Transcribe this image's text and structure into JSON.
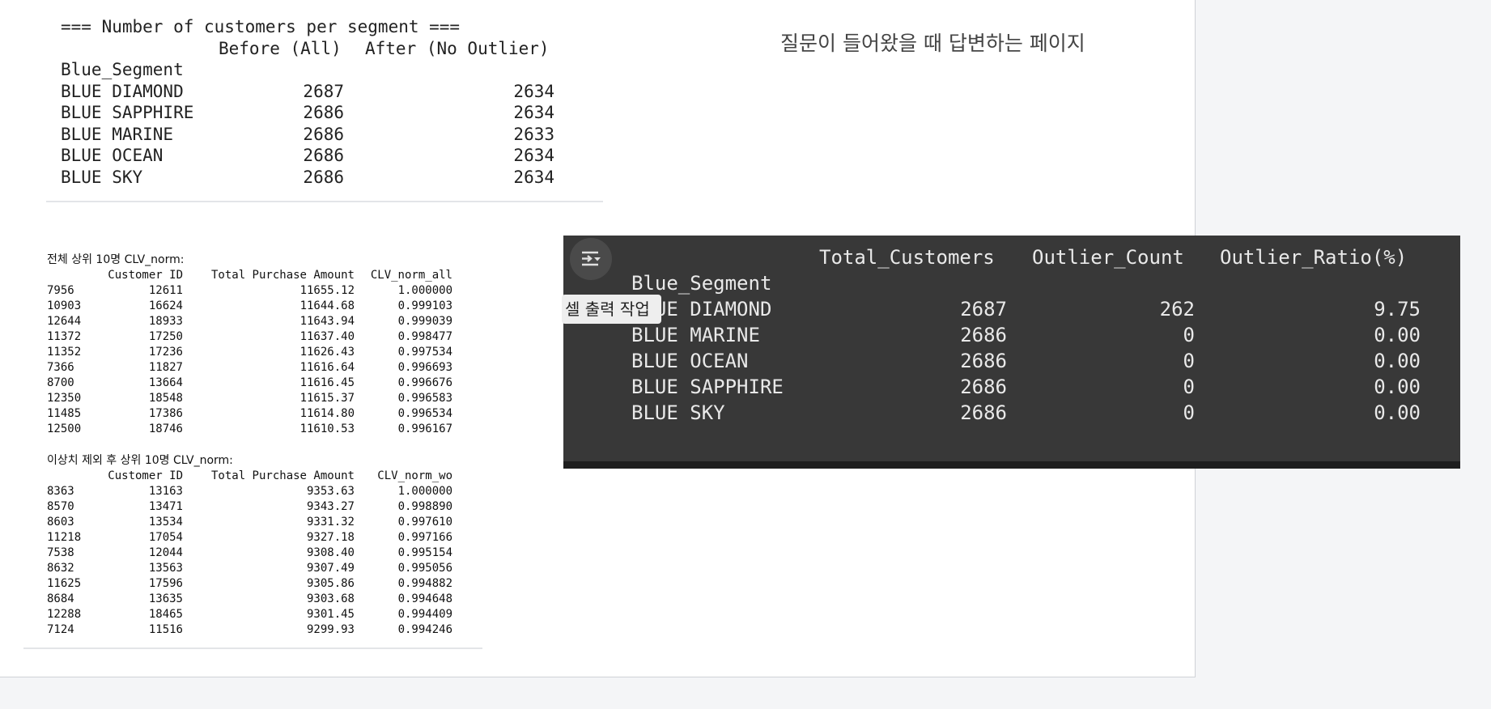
{
  "page_caption": "질문이 들어왔을 때 답변하는 페이지",
  "segment_counts": {
    "title": "=== Number of customers per segment ===",
    "col_before": "Before (All)",
    "col_after": "After (No Outlier)",
    "index_name": "Blue_Segment",
    "rows": [
      {
        "name": "BLUE DIAMOND",
        "before": "2687",
        "after": "2634"
      },
      {
        "name": "BLUE SAPPHIRE",
        "before": "2686",
        "after": "2634"
      },
      {
        "name": "BLUE MARINE",
        "before": "2686",
        "after": "2633"
      },
      {
        "name": "BLUE OCEAN",
        "before": "2686",
        "after": "2634"
      },
      {
        "name": "BLUE SKY",
        "before": "2686",
        "after": "2634"
      }
    ]
  },
  "top10_all": {
    "caption": "전체 상위 10명 CLV_norm:",
    "headers": {
      "customer_id": "Customer ID",
      "total_purchase": "Total Purchase Amount",
      "clv": "CLV_norm_all"
    },
    "rows": [
      {
        "idx": "7956",
        "cid": "12611",
        "tpa": "11655.12",
        "clv": "1.000000"
      },
      {
        "idx": "10903",
        "cid": "16624",
        "tpa": "11644.68",
        "clv": "0.999103"
      },
      {
        "idx": "12644",
        "cid": "18933",
        "tpa": "11643.94",
        "clv": "0.999039"
      },
      {
        "idx": "11372",
        "cid": "17250",
        "tpa": "11637.40",
        "clv": "0.998477"
      },
      {
        "idx": "11352",
        "cid": "17236",
        "tpa": "11626.43",
        "clv": "0.997534"
      },
      {
        "idx": "7366",
        "cid": "11827",
        "tpa": "11616.64",
        "clv": "0.996693"
      },
      {
        "idx": "8700",
        "cid": "13664",
        "tpa": "11616.45",
        "clv": "0.996676"
      },
      {
        "idx": "12350",
        "cid": "18548",
        "tpa": "11615.37",
        "clv": "0.996583"
      },
      {
        "idx": "11485",
        "cid": "17386",
        "tpa": "11614.80",
        "clv": "0.996534"
      },
      {
        "idx": "12500",
        "cid": "18746",
        "tpa": "11610.53",
        "clv": "0.996167"
      }
    ]
  },
  "top10_wo": {
    "caption": "이상치 제외 후 상위 10명 CLV_norm:",
    "headers": {
      "customer_id": "Customer ID",
      "total_purchase": "Total Purchase Amount",
      "clv": "CLV_norm_wo"
    },
    "rows": [
      {
        "idx": "8363",
        "cid": "13163",
        "tpa": "9353.63",
        "clv": "1.000000"
      },
      {
        "idx": "8570",
        "cid": "13471",
        "tpa": "9343.27",
        "clv": "0.998890"
      },
      {
        "idx": "8603",
        "cid": "13534",
        "tpa": "9331.32",
        "clv": "0.997610"
      },
      {
        "idx": "11218",
        "cid": "17054",
        "tpa": "9327.18",
        "clv": "0.997166"
      },
      {
        "idx": "7538",
        "cid": "12044",
        "tpa": "9308.40",
        "clv": "0.995154"
      },
      {
        "idx": "8632",
        "cid": "13563",
        "tpa": "9307.49",
        "clv": "0.995056"
      },
      {
        "idx": "11625",
        "cid": "17596",
        "tpa": "9305.86",
        "clv": "0.994882"
      },
      {
        "idx": "8684",
        "cid": "13635",
        "tpa": "9303.68",
        "clv": "0.994648"
      },
      {
        "idx": "12288",
        "cid": "18465",
        "tpa": "9301.45",
        "clv": "0.994409"
      },
      {
        "idx": "7124",
        "cid": "11516",
        "tpa": "9299.93",
        "clv": "0.994246"
      }
    ]
  },
  "outlier_table": {
    "headers": {
      "total": "Total_Customers",
      "count": "Outlier_Count",
      "ratio": "Outlier_Ratio(%)"
    },
    "index_name": "Blue_Segment",
    "rows": [
      {
        "name": "BLUE DIAMOND",
        "total": "2687",
        "count": "262",
        "ratio": "9.75"
      },
      {
        "name": "BLUE MARINE",
        "total": "2686",
        "count": "0",
        "ratio": "0.00"
      },
      {
        "name": "BLUE OCEAN",
        "total": "2686",
        "count": "0",
        "ratio": "0.00"
      },
      {
        "name": "BLUE SAPPHIRE",
        "total": "2686",
        "count": "0",
        "ratio": "0.00"
      },
      {
        "name": "BLUE SKY",
        "total": "2686",
        "count": "0",
        "ratio": "0.00"
      }
    ]
  },
  "tooltip": "셀 출력 작업",
  "output_action_icon": "output-actions-icon",
  "colors": {
    "panel_bg": "#383838",
    "panel_text": "#e9e9e9",
    "page_bg": "#f4f5f7"
  }
}
